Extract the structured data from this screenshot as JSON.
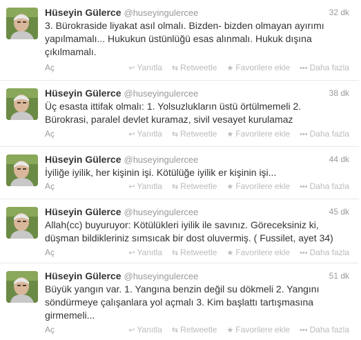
{
  "timeline": {
    "tweets": [
      {
        "name": "Hüseyin Gülerce",
        "handle": "@huseyingulercee",
        "time": "32 dk",
        "text": "3. Bürokraside liyakat asıl olmalı. Bizden- bizden olmayan ayırımı yapılmamalı... Hukukun üstünlüğü esas alınmalı. Hukuk dışına çıkılmamalı.",
        "expand": "Aç"
      },
      {
        "name": "Hüseyin Gülerce",
        "handle": "@huseyingulercee",
        "time": "38 dk",
        "text": "Üç esasta ittifak olmalı: 1. Yolsuzlukların üstü örtülmemeli 2. Bürokrasi, paralel devlet kuramaz, sivil vesayet kurulamaz",
        "expand": "Aç"
      },
      {
        "name": "Hüseyin Gülerce",
        "handle": "@huseyingulercee",
        "time": "44 dk",
        "text": "İyiliğe iyilik, her kişinin işi. Kötülüğe iyilik er kişinin işi...",
        "expand": "Aç"
      },
      {
        "name": "Hüseyin Gülerce",
        "handle": "@huseyingulercee",
        "time": "45 dk",
        "text": "Allah(cc) buyuruyor: Kötülükleri iyilik ile savınız. Göreceksiniz ki, düşman bildikleriniz sımsıcak bir dost oluvermiş. ( Fussilet, ayet 34)",
        "expand": "Aç"
      },
      {
        "name": "Hüseyin Gülerce",
        "handle": "@huseyingulercee",
        "time": "51 dk",
        "text": "Büyük yangın var. 1. Yangına benzin değil su dökmeli 2. Yangını söndürmeye çalışanlara yol açmalı 3. Kim başlattı tartışmasına girmemeli...",
        "expand": "Aç"
      }
    ],
    "actions": {
      "reply": "Yanıtla",
      "retweet": "Retweetle",
      "favorite": "Favorilere ekle",
      "more": "Daha fazla"
    },
    "icons": {
      "reply": "reply-icon",
      "retweet": "retweet-icon",
      "favorite": "star-icon",
      "more": "more-dots-icon"
    }
  }
}
